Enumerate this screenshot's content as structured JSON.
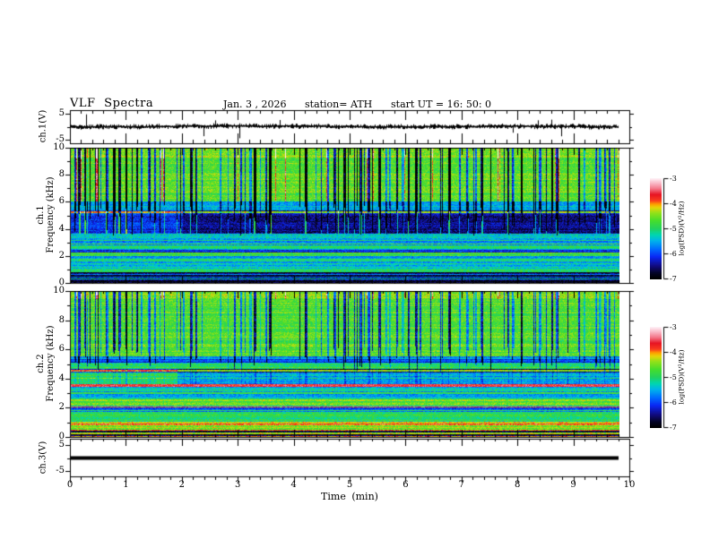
{
  "header": {
    "title": "VLF Spectra",
    "date": "Jan. 3 , 2026",
    "station": "station= ATH",
    "start_ut": "start UT =  16: 50: 0"
  },
  "panels": {
    "ch1_wave": {
      "ylabel": "ch.1(V)",
      "yticks": [
        "5",
        "-5"
      ],
      "ymin": -5,
      "ymax": 5
    },
    "ch1_spec": {
      "ylabel_ch": "ch.1",
      "ylabel_axis": "Frequency  (kHz)",
      "yticks": [
        "10",
        "8",
        "6",
        "4",
        "2",
        "0"
      ],
      "ymin": 0,
      "ymax": 10
    },
    "ch2_spec": {
      "ylabel_ch": "ch.2",
      "ylabel_axis": "Frequency  (kHz)",
      "yticks": [
        "10",
        "8",
        "6",
        "4",
        "2",
        "0"
      ],
      "ymin": 0,
      "ymax": 10
    },
    "ch3_wave": {
      "ylabel": "ch.3(V)",
      "yticks": [
        "5",
        "-5"
      ],
      "ymin": -5,
      "ymax": 5
    }
  },
  "time_axis": {
    "label": "Time  (min)",
    "ticks": [
      "0",
      "1",
      "2",
      "3",
      "4",
      "5",
      "6",
      "7",
      "8",
      "9",
      "10"
    ],
    "min": 0,
    "max": 10,
    "minor_step": 0.2,
    "data_end_min": 9.8
  },
  "colorbar": {
    "label": "log(PSD)(V²/Hz)",
    "ticks": [
      "-3",
      "-4",
      "-5",
      "-6",
      "-7"
    ],
    "vmin": -7,
    "vmax": -3
  },
  "chart_data": {
    "type": "heatmap",
    "description": "VLF spectra quicklook: ch.1 voltage waveform, ch.1 and ch.2 spectrograms (0-10 kHz, log PSD -7..-3 V^2/Hz rainbow scale), ch.3 flat voltage trace; 0-10 min time axis with data ending at 9.8 min.",
    "psd_range": [
      -7,
      -3
    ],
    "freq_range_khz": [
      0,
      10
    ],
    "time_range_min": [
      0,
      10
    ],
    "data_end_min": 9.8,
    "seeds": {
      "streak": 42,
      "spec1": 7,
      "spec2": 13,
      "wave": 99
    },
    "colormap_stops": [
      [
        0.0,
        0,
        0,
        0
      ],
      [
        0.06,
        5,
        5,
        40
      ],
      [
        0.13,
        18,
        12,
        130
      ],
      [
        0.22,
        10,
        40,
        245
      ],
      [
        0.3,
        0,
        110,
        255
      ],
      [
        0.38,
        0,
        180,
        235
      ],
      [
        0.44,
        0,
        215,
        175
      ],
      [
        0.5,
        35,
        210,
        95
      ],
      [
        0.58,
        70,
        222,
        45
      ],
      [
        0.66,
        150,
        225,
        25
      ],
      [
        0.71,
        230,
        215,
        10
      ],
      [
        0.745,
        255,
        160,
        0
      ],
      [
        0.78,
        250,
        60,
        30
      ],
      [
        0.84,
        232,
        20,
        35
      ],
      [
        0.9,
        244,
        120,
        140
      ],
      [
        0.95,
        250,
        180,
        195
      ],
      [
        1.0,
        255,
        240,
        245
      ]
    ],
    "noise": {
      "row": 0.4,
      "pixel": 0.62,
      "rowline_prob": 0.16,
      "rowline_boost": 0.35
    },
    "streak_field": {
      "prob": 0.3,
      "wmax": 3,
      "smin": 0.35,
      "smax": 1.0,
      "warm_prob": 0.05
    },
    "waveform_ch1": {
      "mean_v": 0,
      "band_halfwidth_v": 0.8,
      "spike_prob": 0.02,
      "spike_amp_v": [
        1.2,
        4.3
      ],
      "neg_spike_frac": 0.58
    },
    "waveform_ch3": {
      "value_v": 0,
      "line_thickness_px": 4
    },
    "spectrograms": [
      {
        "channel": "ch.1",
        "bands": [
          [
            9.3,
            10.01,
            -4.5
          ],
          [
            6.0,
            9.3,
            -4.68
          ],
          [
            5.38,
            6.0,
            -5.55
          ],
          [
            3.62,
            5.38,
            -6.1
          ],
          [
            3.3,
            3.62,
            -5.35
          ],
          [
            2.5,
            3.3,
            -5.65
          ],
          [
            2.28,
            2.5,
            -6.15
          ],
          [
            1.98,
            2.28,
            -5.0
          ],
          [
            1.78,
            1.98,
            -6.05
          ],
          [
            1.02,
            1.78,
            -5.5
          ],
          [
            0.78,
            1.02,
            -4.85
          ],
          [
            0.32,
            0.78,
            -6.75
          ],
          [
            0.24,
            0.32,
            -5.15
          ],
          [
            0.0,
            0.24,
            -6.9
          ]
        ],
        "hlines": [
          {
            "f": 5.22,
            "hw": 0.055,
            "v": -3.95
          },
          {
            "f": 3.5,
            "hw": 0.035,
            "v": -5.15
          },
          {
            "f": 2.1,
            "hw": 0.03,
            "v": -4.9
          },
          {
            "f": 0.62,
            "hw": 0.025,
            "v": -5.9
          },
          {
            "f": 0.45,
            "hw": 0.02,
            "v": -5.6
          }
        ],
        "harmonics": {
          "count": 14,
          "f_lo": 1.0,
          "f_hi": 3.45,
          "boost": 0.55
        },
        "step": {
          "t": 2.0,
          "f_lo": 3.62,
          "f_hi": 5.38,
          "dv": -0.4
        },
        "streak": {
          "dark_dv": -2.9,
          "fbot_base": 3.5,
          "fbot_rand": 2.3,
          "bright": {
            "f_lo": 3.62,
            "f_hi": 5.38,
            "dv": 1.6,
            "frac": 0.45
          },
          "warm": {
            "f_lo": 6.0,
            "dv": 0.85,
            "top_f": 9.2,
            "top_dv": 0.9
          }
        }
      },
      {
        "channel": "ch.2",
        "bands": [
          [
            9.42,
            10.01,
            -4.4
          ],
          [
            5.5,
            9.42,
            -4.68
          ],
          [
            5.02,
            5.5,
            -5.7
          ],
          [
            4.66,
            5.02,
            -5.05
          ],
          [
            4.44,
            4.66,
            -6.0
          ],
          [
            3.64,
            4.44,
            -4.95
          ],
          [
            3.42,
            3.64,
            -3.8
          ],
          [
            2.64,
            3.42,
            -5.5
          ],
          [
            2.36,
            2.64,
            -4.95
          ],
          [
            2.12,
            2.36,
            -4.5
          ],
          [
            1.84,
            2.12,
            -5.9
          ],
          [
            1.04,
            1.84,
            -5.0
          ],
          [
            0.8,
            1.04,
            -4.2
          ],
          [
            0.52,
            0.8,
            -4.55
          ],
          [
            0.44,
            0.52,
            -3.95
          ],
          [
            0.3,
            0.44,
            -6.6
          ],
          [
            0.21,
            0.3,
            -4.35
          ],
          [
            0.06,
            0.21,
            -6.8
          ],
          [
            0.0,
            0.06,
            -3.9
          ]
        ],
        "hlines": [
          {
            "f": 4.54,
            "hw": 0.04,
            "v": -3.85
          },
          {
            "f": 5.12,
            "hw": 0.04,
            "v": -6.4
          },
          {
            "f": 5.32,
            "hw": 0.035,
            "v": -6.2
          },
          {
            "f": 2.06,
            "hw": 0.035,
            "v": -4.05
          },
          {
            "f": 1.92,
            "hw": 0.03,
            "v": -6.5
          },
          {
            "f": 1.76,
            "hw": 0.025,
            "v": -6.3
          },
          {
            "f": 0.86,
            "hw": 0.04,
            "v": -3.85
          },
          {
            "f": 0.64,
            "hw": 0.022,
            "v": -4.2
          }
        ],
        "harmonics": {
          "count": 10,
          "f_lo": 1.0,
          "f_hi": 3.4,
          "boost": 0.5
        },
        "step": {
          "t": 1.9,
          "f_lo": 3.64,
          "f_hi": 4.66,
          "dv": -0.55
        },
        "streak": {
          "dark_dv": -2.1,
          "fbot_base": 4.4,
          "fbot_rand": 1.8,
          "bright": {
            "f_lo": 3.64,
            "f_hi": 4.66,
            "dv": -0.5,
            "frac": 0.5
          },
          "warm": {
            "f_lo": 9.42,
            "dv": 0.8,
            "top_f": 9.7,
            "top_dv": 0.5
          }
        }
      }
    ]
  }
}
